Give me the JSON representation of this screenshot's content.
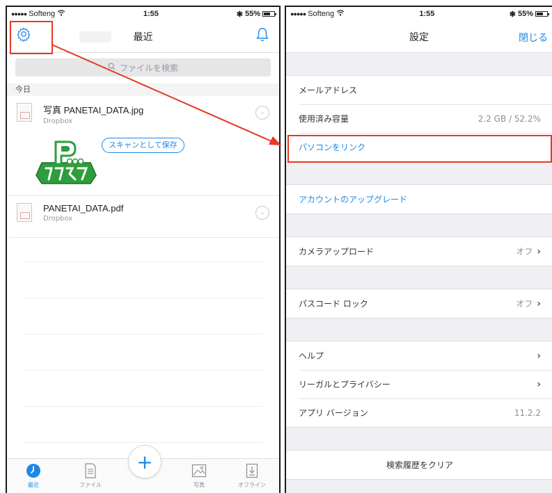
{
  "status": {
    "carrier": "Softeng",
    "time": "1:55",
    "battery": "55%"
  },
  "left": {
    "title": "最近",
    "search_placeholder": "ファイルを検索",
    "section_today": "今日",
    "files": [
      {
        "name": "写真 PANETAI_DATA.jpg",
        "source": "Dropbox"
      },
      {
        "name": "PANETAI_DATA.pdf",
        "source": "Dropbox"
      }
    ],
    "scan_button": "スキャンとして保存",
    "tabs": [
      {
        "label": "最近",
        "icon": "clock-icon"
      },
      {
        "label": "ファイル",
        "icon": "document-icon"
      },
      {
        "label": "写真",
        "icon": "photo-icon"
      },
      {
        "label": "オフライン",
        "icon": "offline-download-icon"
      }
    ],
    "fab_label": "+"
  },
  "right": {
    "title": "設定",
    "close": "閉じる",
    "rows": {
      "email": "メールアドレス",
      "storage": "使用済み容量",
      "storage_value": "2.2 GB / 52.2%",
      "link_pc": "パソコンをリンク",
      "upgrade": "アカウントのアップグレード",
      "camera_upload": "カメラアップロード",
      "camera_upload_value": "オフ",
      "passcode": "パスコード ロック",
      "passcode_value": "オフ",
      "help": "ヘルプ",
      "legal": "リーガルとプライバシー",
      "app_version": "アプリ バージョン",
      "app_version_value": "11.2.2",
      "clear_history": "検索履歴をクリア"
    }
  },
  "colors": {
    "accent_blue": "#1e88e5",
    "highlight_red": "#e53923",
    "logo_green": "#2e9e3c"
  }
}
